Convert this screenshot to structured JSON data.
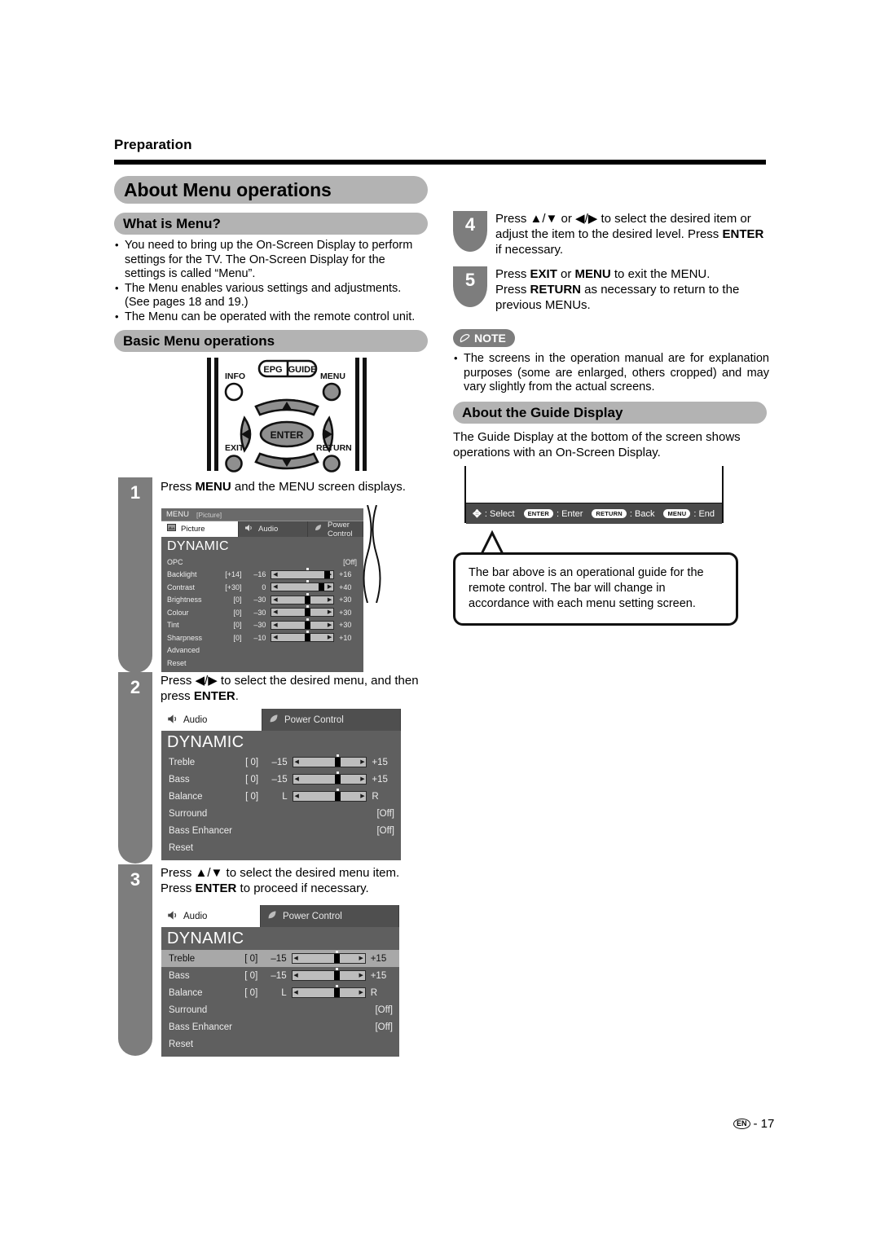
{
  "page": {
    "section_label": "Preparation",
    "footer_mark": "EN",
    "footer_page": "- 17"
  },
  "headings": {
    "main": "About Menu operations",
    "what_is_menu": "What is Menu?",
    "basic_menu": "Basic Menu operations",
    "guide_display": "About the Guide Display",
    "note": "NOTE"
  },
  "what_is_menu_bullets": [
    "You need to bring up the On-Screen Display to perform settings for the TV. The On-Screen Display for the settings is called “Menu”.",
    "The Menu enables various settings and adjustments. (See pages 18 and 19.)",
    "The Menu can be operated with the remote control unit."
  ],
  "note_bullets": [
    "The screens in the operation manual are for explanation purposes (some are enlarged, others cropped) and may vary slightly from the actual screens."
  ],
  "guide_display": {
    "paragraph": "The Guide Display at the bottom of the screen shows operations with an On-Screen Display.",
    "bar_items": [
      {
        "key": "✥",
        "key_style": "glyph",
        "label": ": Select"
      },
      {
        "key": "ENTER",
        "key_style": "cap",
        "label": ": Enter"
      },
      {
        "key": "RETURN",
        "key_style": "cap",
        "label": ": Back"
      },
      {
        "key": "MENU",
        "key_style": "cap",
        "label": ": End"
      }
    ],
    "callout": "The bar above is an operational guide for the remote control. The bar will change in accordance with each menu setting screen."
  },
  "remote": {
    "labels": {
      "info": "INFO",
      "epg": "EPG",
      "guide": "GUIDE",
      "menu": "MENU",
      "enter": "ENTER",
      "exit": "EXIT",
      "return": "RETURN"
    }
  },
  "steps": {
    "one": {
      "number": "1",
      "text_html": "Press <b>MENU</b> and the MENU screen displays."
    },
    "two": {
      "number": "2",
      "text_html": "Press ◀/▶ to select the desired menu, and then press <b>ENTER</b>."
    },
    "three": {
      "number": "3",
      "text_html": "Press ▲/▼ to select the desired menu item. Press <b>ENTER</b> to proceed if necessary."
    },
    "four": {
      "number": "4",
      "text_html": "Press ▲/▼ or ◀/▶ to select the desired item or adjust the item to the desired level. Press <b>ENTER</b> if necessary."
    },
    "five": {
      "number": "5",
      "text_html": "Press <b>EXIT</b> or <b>MENU</b> to exit the MENU.<br>Press <b>RETURN</b> as necessary to return to the previous MENUs."
    }
  },
  "osd_picture": {
    "title": "MENU",
    "title_bracket": "[Picture]",
    "tabs": [
      {
        "label": "Picture",
        "icon": "picture-icon",
        "active": true
      },
      {
        "label": "Audio",
        "icon": "speaker-icon",
        "active": false
      },
      {
        "label": "Power Control",
        "icon": "leaf-icon",
        "active": false
      }
    ],
    "mode": "DYNAMIC",
    "rows": [
      {
        "name": "OPC",
        "value": "",
        "min": "",
        "max": "",
        "right": "[Off]",
        "slider": false
      },
      {
        "name": "Backlight",
        "value": "[+14]",
        "min": "–16",
        "max": "+16",
        "right": "",
        "slider": true,
        "thumb_pct": 88
      },
      {
        "name": "Contrast",
        "value": "[+30]",
        "min": "0",
        "max": "+40",
        "right": "",
        "slider": true,
        "thumb_pct": 76
      },
      {
        "name": "Brightness",
        "value": "[0]",
        "min": "–30",
        "max": "+30",
        "right": "",
        "slider": true,
        "thumb_pct": 50
      },
      {
        "name": "Colour",
        "value": "[0]",
        "min": "–30",
        "max": "+30",
        "right": "",
        "slider": true,
        "thumb_pct": 50
      },
      {
        "name": "Tint",
        "value": "[0]",
        "min": "–30",
        "max": "+30",
        "right": "",
        "slider": true,
        "thumb_pct": 50
      },
      {
        "name": "Sharpness",
        "value": "[0]",
        "min": "–10",
        "max": "+10",
        "right": "",
        "slider": true,
        "thumb_pct": 50
      },
      {
        "name": "Advanced",
        "value": "",
        "min": "",
        "max": "",
        "right": "",
        "slider": false
      },
      {
        "name": "Reset",
        "value": "",
        "min": "",
        "max": "",
        "right": "",
        "slider": false
      }
    ]
  },
  "osd_audio_a": {
    "tabs": [
      {
        "label": "Audio",
        "icon": "speaker-icon",
        "active": true
      },
      {
        "label": "Power Control",
        "icon": "leaf-icon",
        "active": false
      }
    ],
    "mode": "DYNAMIC",
    "rows": [
      {
        "name": "Treble",
        "value": "[  0]",
        "min": "–15",
        "max": "+15",
        "right": "",
        "slider": true,
        "thumb_pct": 50,
        "selected": false
      },
      {
        "name": "Bass",
        "value": "[  0]",
        "min": "–15",
        "max": "+15",
        "right": "",
        "slider": true,
        "thumb_pct": 50,
        "selected": false
      },
      {
        "name": "Balance",
        "value": "[  0]",
        "min": "L",
        "max": "R",
        "right": "",
        "slider": true,
        "thumb_pct": 50,
        "selected": false
      },
      {
        "name": "Surround",
        "value": "",
        "min": "",
        "max": "",
        "right": "[Off]",
        "slider": false,
        "selected": false
      },
      {
        "name": "Bass Enhancer",
        "value": "",
        "min": "",
        "max": "",
        "right": "[Off]",
        "slider": false,
        "selected": false
      },
      {
        "name": "Reset",
        "value": "",
        "min": "",
        "max": "",
        "right": "",
        "slider": false,
        "selected": false
      }
    ]
  },
  "osd_audio_b": {
    "tabs": [
      {
        "label": "Audio",
        "icon": "speaker-icon",
        "active": true
      },
      {
        "label": "Power Control",
        "icon": "leaf-icon",
        "active": false
      }
    ],
    "mode": "DYNAMIC",
    "rows": [
      {
        "name": "Treble",
        "value": "[  0]",
        "min": "–15",
        "max": "+15",
        "right": "",
        "slider": true,
        "thumb_pct": 50,
        "selected": true
      },
      {
        "name": "Bass",
        "value": "[  0]",
        "min": "–15",
        "max": "+15",
        "right": "",
        "slider": true,
        "thumb_pct": 50,
        "selected": false
      },
      {
        "name": "Balance",
        "value": "[  0]",
        "min": "L",
        "max": "R",
        "right": "",
        "slider": true,
        "thumb_pct": 50,
        "selected": false
      },
      {
        "name": "Surround",
        "value": "",
        "min": "",
        "max": "",
        "right": "[Off]",
        "slider": false,
        "selected": false
      },
      {
        "name": "Bass Enhancer",
        "value": "",
        "min": "",
        "max": "",
        "right": "[Off]",
        "slider": false,
        "selected": false
      },
      {
        "name": "Reset",
        "value": "",
        "min": "",
        "max": "",
        "right": "",
        "slider": false,
        "selected": false
      }
    ]
  },
  "colors": {
    "pill_grey": "#b3b3b3",
    "badge_grey": "#7d7d7d",
    "osd_bg": "#5f5f5f",
    "osd_selected": "#a8a8a8"
  }
}
